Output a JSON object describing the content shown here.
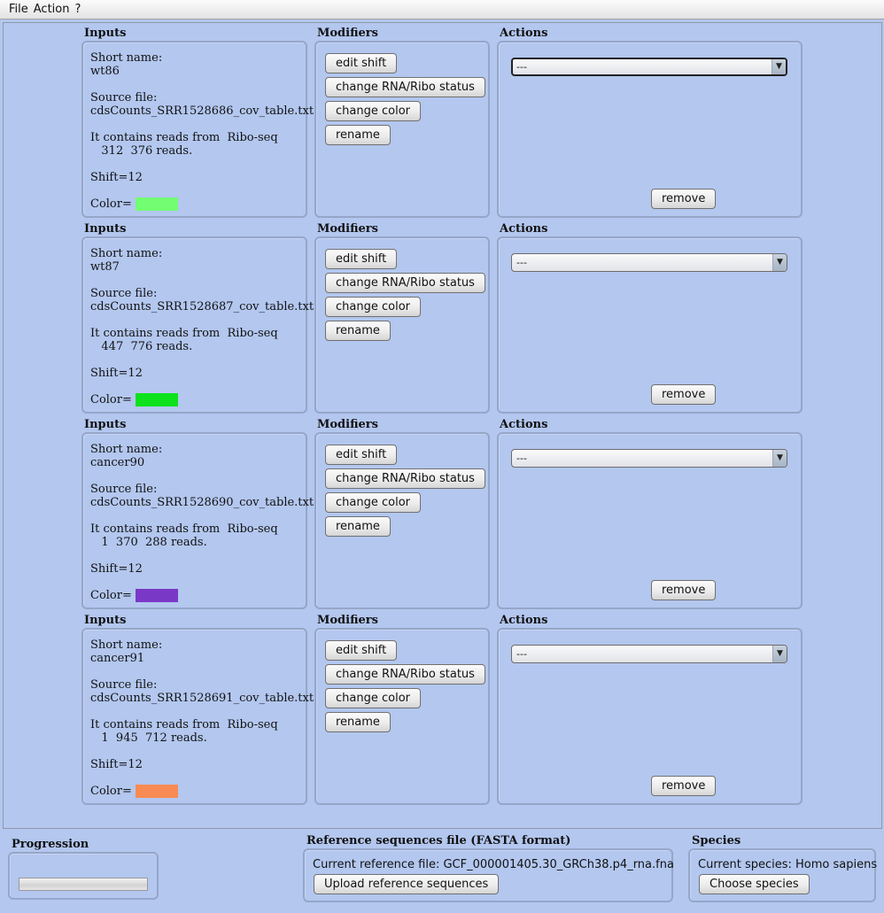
{
  "menu": [
    "File",
    "Action",
    "?"
  ],
  "section_titles": {
    "inputs": "Inputs",
    "modifiers": "Modifiers",
    "actions": "Actions"
  },
  "labels": {
    "short_name": "Short name:",
    "source_file": "Source file:",
    "contains": "It contains reads from  Ribo-seq",
    "color": "Color= "
  },
  "modifiers": {
    "edit_shift": "edit shift",
    "change_status": "change RNA/Ribo status",
    "change_color": "change color",
    "rename": "rename"
  },
  "actions": {
    "combo_value": "---",
    "remove": "remove"
  },
  "samples": [
    {
      "short_name": "wt86",
      "source_file": "cdsCounts_SRR1528686_cov_table.txt",
      "reads": "   312  376 reads.",
      "shift": "Shift=12",
      "color": "#72fd72"
    },
    {
      "short_name": "wt87",
      "source_file": "cdsCounts_SRR1528687_cov_table.txt",
      "reads": "   447  776 reads.",
      "shift": "Shift=12",
      "color": "#0de21d"
    },
    {
      "short_name": "cancer90",
      "source_file": "cdsCounts_SRR1528690_cov_table.txt",
      "reads": "   1  370  288 reads.",
      "shift": "Shift=12",
      "color": "#7a38c6"
    },
    {
      "short_name": "cancer91",
      "source_file": "cdsCounts_SRR1528691_cov_table.txt",
      "reads": "   1  945  712 reads.",
      "shift": "Shift=12",
      "color": "#f88a53"
    }
  ],
  "progression": {
    "title": "Progression",
    "value_percent": 0
  },
  "reference": {
    "title": "Reference sequences file (FASTA format)",
    "current": "Current reference file: GCF_000001405.30_GRCh38.p4_rna.fna",
    "upload_button": "Upload reference sequences"
  },
  "species": {
    "title": "Species",
    "current": "Current species: Homo sapiens",
    "choose_button": "Choose species"
  }
}
